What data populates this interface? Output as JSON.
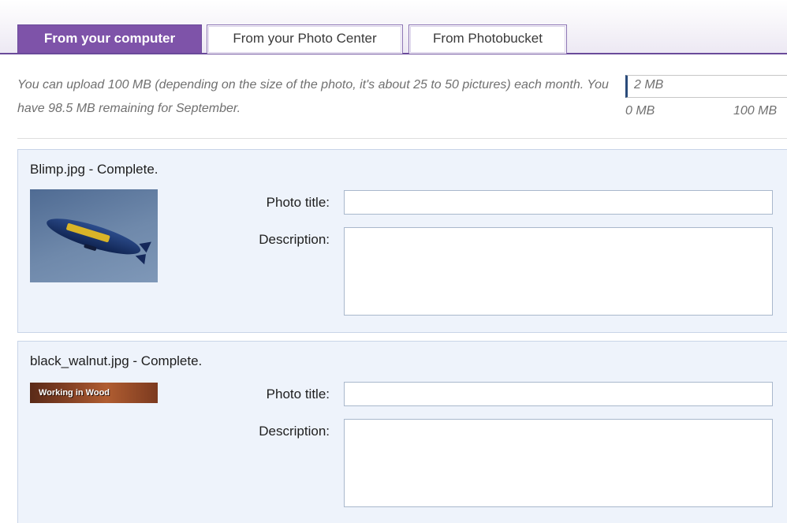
{
  "tabs": [
    {
      "label": "From your computer",
      "active": true
    },
    {
      "label": "From your Photo Center",
      "active": false
    },
    {
      "label": "From Photobucket",
      "active": false
    }
  ],
  "quota": {
    "message": "You can upload 100 MB (depending on the size of the photo, it's about 25 to 50 pictures) each month. You have 98.5 MB remaining for September.",
    "meter_value": "2 MB",
    "meter_min": "0 MB",
    "meter_max": "100 MB"
  },
  "uploads": [
    {
      "status": "Blimp.jpg - Complete.",
      "thumbnail_icon": "blimp-photo",
      "title_label": "Photo title:",
      "title_value": "",
      "description_label": "Description:",
      "description_value": ""
    },
    {
      "status": "black_walnut.jpg - Complete.",
      "thumbnail_icon": "wood-banner-image",
      "thumbnail_text": "Working in Wood",
      "title_label": "Photo title:",
      "title_value": "",
      "description_label": "Description:",
      "description_value": ""
    }
  ],
  "colors": {
    "tab_active_bg": "#7e53a9",
    "tab_border": "#6a4a9a",
    "panel_bg": "#eef3fb",
    "muted_text": "#707070"
  }
}
